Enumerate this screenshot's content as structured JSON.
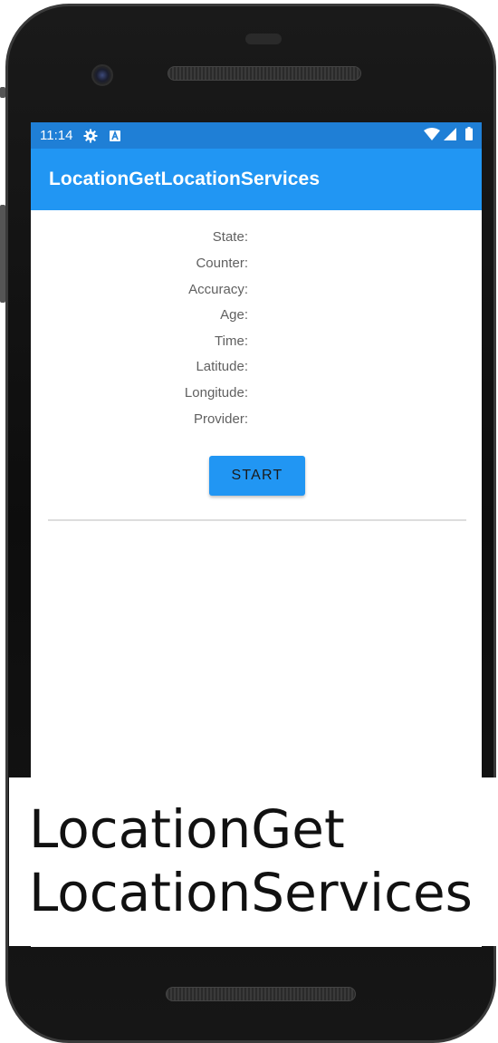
{
  "status_bar": {
    "time": "11:14",
    "icons": [
      "settings-icon",
      "a-notification-icon",
      "wifi-icon",
      "signal-icon",
      "battery-icon"
    ]
  },
  "app_bar": {
    "title": "LocationGetLocationServices"
  },
  "info_labels": [
    "State:",
    "Counter:",
    "Accuracy:",
    "Age:",
    "Time:",
    "Latitude:",
    "Longitude:",
    "Provider:"
  ],
  "start_button": {
    "label": "START"
  },
  "caption": {
    "line1": "LocationGet",
    "line2": "LocationServices"
  },
  "colors": {
    "status_bar": "#1f7fd6",
    "app_bar": "#2196f3",
    "button": "#2196f3"
  }
}
